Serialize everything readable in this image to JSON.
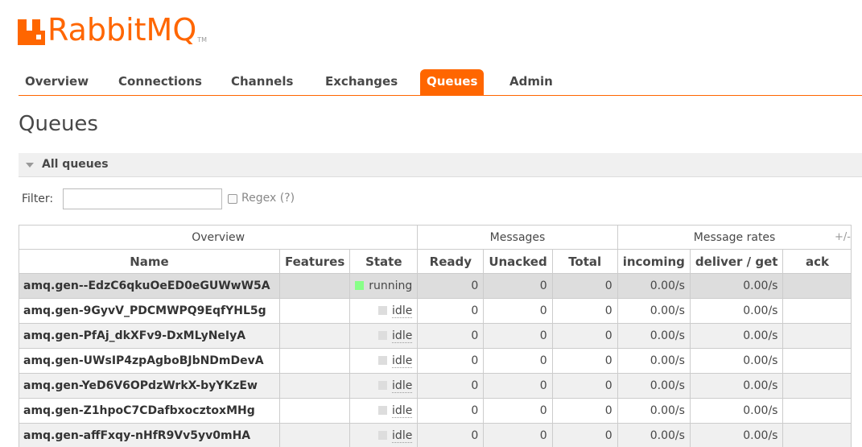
{
  "brand": {
    "name": "RabbitMQ",
    "tm": "TM",
    "color": "#ff6600"
  },
  "nav": {
    "tabs": [
      {
        "label": "Overview",
        "active": false
      },
      {
        "label": "Connections",
        "active": false
      },
      {
        "label": "Channels",
        "active": false
      },
      {
        "label": "Exchanges",
        "active": false
      },
      {
        "label": "Queues",
        "active": true
      },
      {
        "label": "Admin",
        "active": false
      }
    ]
  },
  "page": {
    "title": "Queues"
  },
  "section": {
    "title": "All queues",
    "toggle_icon": "triangle-down-icon"
  },
  "filter": {
    "label": "Filter:",
    "value": "",
    "regex_label": "Regex",
    "regex_help": "(?)",
    "regex_checked": false
  },
  "table": {
    "groups": [
      "Overview",
      "Messages",
      "Message rates"
    ],
    "plus_minus": "+/-",
    "columns": [
      "Name",
      "Features",
      "State",
      "Ready",
      "Unacked",
      "Total",
      "incoming",
      "deliver / get",
      "ack"
    ],
    "rows": [
      {
        "name": "amq.gen--EdzC6qkuOeED0eGUWwW5A",
        "features": "",
        "state": "running",
        "ready": "0",
        "unacked": "0",
        "total": "0",
        "incoming": "0.00/s",
        "deliver_get": "0.00/s",
        "ack": ""
      },
      {
        "name": "amq.gen-9GyvV_PDCMWPQ9EqfYHL5g",
        "features": "",
        "state": "idle",
        "ready": "0",
        "unacked": "0",
        "total": "0",
        "incoming": "0.00/s",
        "deliver_get": "0.00/s",
        "ack": ""
      },
      {
        "name": "amq.gen-PfAj_dkXFv9-DxMLyNeIyA",
        "features": "",
        "state": "idle",
        "ready": "0",
        "unacked": "0",
        "total": "0",
        "incoming": "0.00/s",
        "deliver_get": "0.00/s",
        "ack": ""
      },
      {
        "name": "amq.gen-UWsIP4zpAgboBJbNDmDevA",
        "features": "",
        "state": "idle",
        "ready": "0",
        "unacked": "0",
        "total": "0",
        "incoming": "0.00/s",
        "deliver_get": "0.00/s",
        "ack": ""
      },
      {
        "name": "amq.gen-YeD6V6OPdzWrkX-byYKzEw",
        "features": "",
        "state": "idle",
        "ready": "0",
        "unacked": "0",
        "total": "0",
        "incoming": "0.00/s",
        "deliver_get": "0.00/s",
        "ack": ""
      },
      {
        "name": "amq.gen-Z1hpoC7CDafbxocztoxMHg",
        "features": "",
        "state": "idle",
        "ready": "0",
        "unacked": "0",
        "total": "0",
        "incoming": "0.00/s",
        "deliver_get": "0.00/s",
        "ack": ""
      },
      {
        "name": "amq.gen-affFxqy-nHfR9Vv5yv0mHA",
        "features": "",
        "state": "idle",
        "ready": "0",
        "unacked": "0",
        "total": "0",
        "incoming": "0.00/s",
        "deliver_get": "0.00/s",
        "ack": ""
      }
    ]
  },
  "colors": {
    "accent": "#ff6600",
    "running": "#88ff88",
    "idle": "#dddddd"
  }
}
